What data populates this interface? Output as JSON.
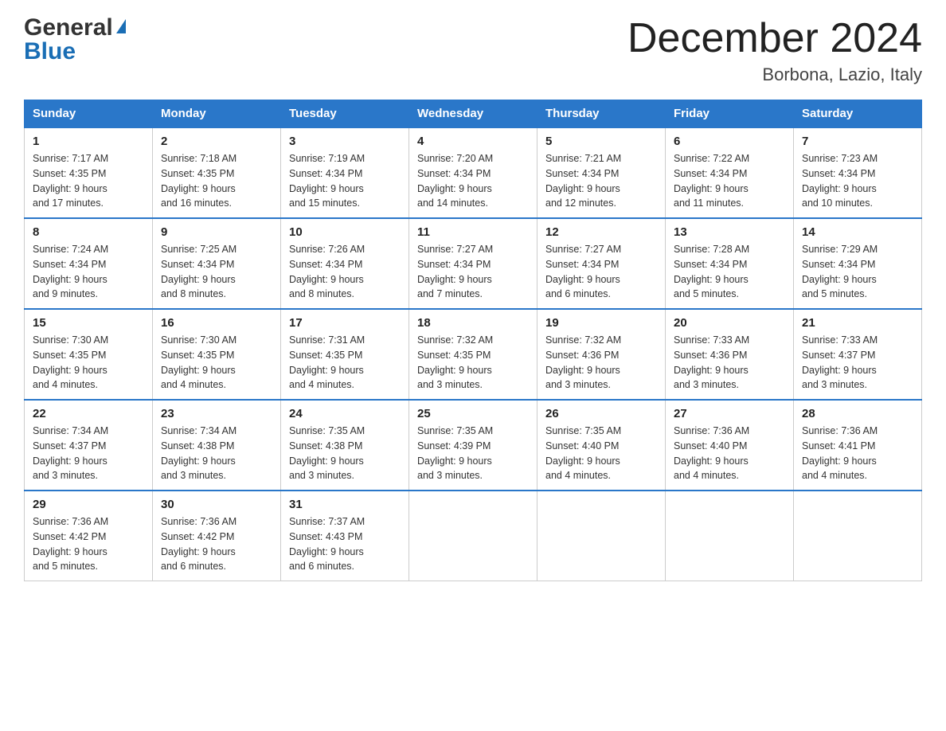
{
  "logo": {
    "general": "General",
    "blue": "Blue",
    "triangle": "▲"
  },
  "header": {
    "month_year": "December 2024",
    "location": "Borbona, Lazio, Italy"
  },
  "weekdays": [
    "Sunday",
    "Monday",
    "Tuesday",
    "Wednesday",
    "Thursday",
    "Friday",
    "Saturday"
  ],
  "weeks": [
    [
      {
        "day": "1",
        "sunrise": "7:17 AM",
        "sunset": "4:35 PM",
        "daylight": "9 hours and 17 minutes."
      },
      {
        "day": "2",
        "sunrise": "7:18 AM",
        "sunset": "4:35 PM",
        "daylight": "9 hours and 16 minutes."
      },
      {
        "day": "3",
        "sunrise": "7:19 AM",
        "sunset": "4:34 PM",
        "daylight": "9 hours and 15 minutes."
      },
      {
        "day": "4",
        "sunrise": "7:20 AM",
        "sunset": "4:34 PM",
        "daylight": "9 hours and 14 minutes."
      },
      {
        "day": "5",
        "sunrise": "7:21 AM",
        "sunset": "4:34 PM",
        "daylight": "9 hours and 12 minutes."
      },
      {
        "day": "6",
        "sunrise": "7:22 AM",
        "sunset": "4:34 PM",
        "daylight": "9 hours and 11 minutes."
      },
      {
        "day": "7",
        "sunrise": "7:23 AM",
        "sunset": "4:34 PM",
        "daylight": "9 hours and 10 minutes."
      }
    ],
    [
      {
        "day": "8",
        "sunrise": "7:24 AM",
        "sunset": "4:34 PM",
        "daylight": "9 hours and 9 minutes."
      },
      {
        "day": "9",
        "sunrise": "7:25 AM",
        "sunset": "4:34 PM",
        "daylight": "9 hours and 8 minutes."
      },
      {
        "day": "10",
        "sunrise": "7:26 AM",
        "sunset": "4:34 PM",
        "daylight": "9 hours and 8 minutes."
      },
      {
        "day": "11",
        "sunrise": "7:27 AM",
        "sunset": "4:34 PM",
        "daylight": "9 hours and 7 minutes."
      },
      {
        "day": "12",
        "sunrise": "7:27 AM",
        "sunset": "4:34 PM",
        "daylight": "9 hours and 6 minutes."
      },
      {
        "day": "13",
        "sunrise": "7:28 AM",
        "sunset": "4:34 PM",
        "daylight": "9 hours and 5 minutes."
      },
      {
        "day": "14",
        "sunrise": "7:29 AM",
        "sunset": "4:34 PM",
        "daylight": "9 hours and 5 minutes."
      }
    ],
    [
      {
        "day": "15",
        "sunrise": "7:30 AM",
        "sunset": "4:35 PM",
        "daylight": "9 hours and 4 minutes."
      },
      {
        "day": "16",
        "sunrise": "7:30 AM",
        "sunset": "4:35 PM",
        "daylight": "9 hours and 4 minutes."
      },
      {
        "day": "17",
        "sunrise": "7:31 AM",
        "sunset": "4:35 PM",
        "daylight": "9 hours and 4 minutes."
      },
      {
        "day": "18",
        "sunrise": "7:32 AM",
        "sunset": "4:35 PM",
        "daylight": "9 hours and 3 minutes."
      },
      {
        "day": "19",
        "sunrise": "7:32 AM",
        "sunset": "4:36 PM",
        "daylight": "9 hours and 3 minutes."
      },
      {
        "day": "20",
        "sunrise": "7:33 AM",
        "sunset": "4:36 PM",
        "daylight": "9 hours and 3 minutes."
      },
      {
        "day": "21",
        "sunrise": "7:33 AM",
        "sunset": "4:37 PM",
        "daylight": "9 hours and 3 minutes."
      }
    ],
    [
      {
        "day": "22",
        "sunrise": "7:34 AM",
        "sunset": "4:37 PM",
        "daylight": "9 hours and 3 minutes."
      },
      {
        "day": "23",
        "sunrise": "7:34 AM",
        "sunset": "4:38 PM",
        "daylight": "9 hours and 3 minutes."
      },
      {
        "day": "24",
        "sunrise": "7:35 AM",
        "sunset": "4:38 PM",
        "daylight": "9 hours and 3 minutes."
      },
      {
        "day": "25",
        "sunrise": "7:35 AM",
        "sunset": "4:39 PM",
        "daylight": "9 hours and 3 minutes."
      },
      {
        "day": "26",
        "sunrise": "7:35 AM",
        "sunset": "4:40 PM",
        "daylight": "9 hours and 4 minutes."
      },
      {
        "day": "27",
        "sunrise": "7:36 AM",
        "sunset": "4:40 PM",
        "daylight": "9 hours and 4 minutes."
      },
      {
        "day": "28",
        "sunrise": "7:36 AM",
        "sunset": "4:41 PM",
        "daylight": "9 hours and 4 minutes."
      }
    ],
    [
      {
        "day": "29",
        "sunrise": "7:36 AM",
        "sunset": "4:42 PM",
        "daylight": "9 hours and 5 minutes."
      },
      {
        "day": "30",
        "sunrise": "7:36 AM",
        "sunset": "4:42 PM",
        "daylight": "9 hours and 6 minutes."
      },
      {
        "day": "31",
        "sunrise": "7:37 AM",
        "sunset": "4:43 PM",
        "daylight": "9 hours and 6 minutes."
      },
      null,
      null,
      null,
      null
    ]
  ],
  "labels": {
    "sunrise": "Sunrise:",
    "sunset": "Sunset:",
    "daylight": "Daylight:"
  }
}
